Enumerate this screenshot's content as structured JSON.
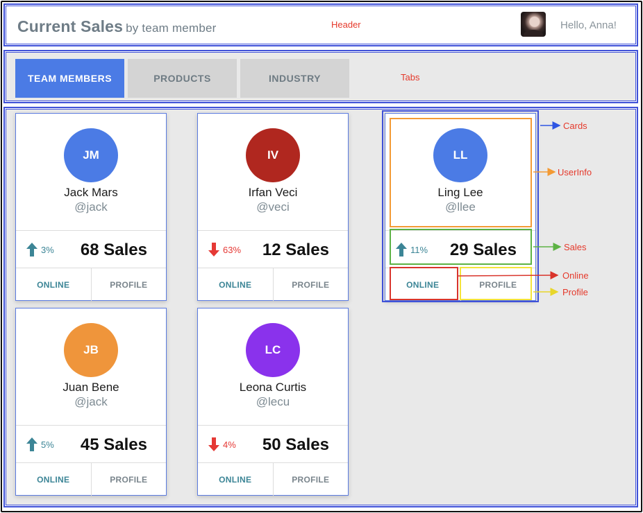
{
  "header": {
    "title": "Current Sales",
    "subtitle": "by team member",
    "annotation": "Header",
    "greeting": "Hello, Anna!",
    "avatar_icon": "user-photo"
  },
  "tabs": {
    "annotation": "Tabs",
    "items": [
      {
        "label": "TEAM MEMBERS",
        "active": true
      },
      {
        "label": "PRODUCTS",
        "active": false
      },
      {
        "label": "INDUSTRY",
        "active": false
      }
    ]
  },
  "cards": [
    {
      "initials": "JM",
      "name": "Jack Mars",
      "handle": "@jack",
      "trend": "up",
      "pct": "3%",
      "sales": "68 Sales",
      "avatar_color": "#4b7be5",
      "online_label": "ONLINE",
      "profile_label": "PROFILE"
    },
    {
      "initials": "IV",
      "name": "Irfan Veci",
      "handle": "@veci",
      "trend": "down",
      "pct": "63%",
      "sales": "12 Sales",
      "avatar_color": "#b0271f",
      "online_label": "ONLINE",
      "profile_label": "PROFILE"
    },
    {
      "initials": "LL",
      "name": "Ling Lee",
      "handle": "@llee",
      "trend": "up",
      "pct": "11%",
      "sales": "29 Sales",
      "avatar_color": "#4b7be5",
      "online_label": "ONLINE",
      "profile_label": "PROFILE"
    },
    {
      "initials": "JB",
      "name": "Juan Bene",
      "handle": "@jack",
      "trend": "up",
      "pct": "5%",
      "sales": "45 Sales",
      "avatar_color": "#ef953b",
      "online_label": "ONLINE",
      "profile_label": "PROFILE"
    },
    {
      "initials": "LC",
      "name": "Leona Curtis",
      "handle": "@lecu",
      "trend": "down",
      "pct": "4%",
      "sales": "50 Sales",
      "avatar_color": "#8a32ec",
      "online_label": "ONLINE",
      "profile_label": "PROFILE"
    }
  ],
  "annotations": {
    "cards": "Cards",
    "userinfo": "UserInfo",
    "sales": "Sales",
    "online": "Online",
    "profile": "Profile"
  },
  "colors": {
    "accent": "#4b7be5",
    "trend_up": "#3c8596",
    "trend_down": "#e53935",
    "annotation_text": "#e5392b"
  }
}
